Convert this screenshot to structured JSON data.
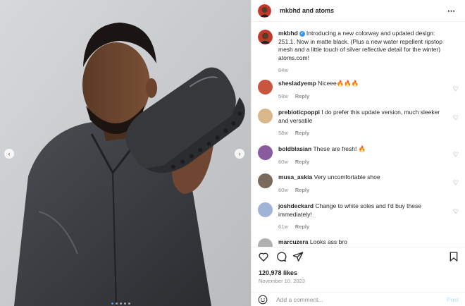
{
  "header": {
    "title": "mkbhd and atoms",
    "more_icon": "more-icon"
  },
  "caption": {
    "user": "mkbhd",
    "text": "Introducing a new colorway and updated design: 251.1. Now in matte black. (Plus a new water repellent ripstop mesh and a little touch of silver reflective detail for the winter) atoms.com!",
    "time": "64w"
  },
  "comments": [
    {
      "user": "shesladyemp",
      "text": "Niceee🔥🔥🔥",
      "time": "58w",
      "reply": "Reply",
      "avatar_color": "#c8553d"
    },
    {
      "user": "prebioticpoppi",
      "text": "I do prefer this update version, much sleeker and versatile",
      "time": "58w",
      "reply": "Reply",
      "avatar_color": "#d9b78a"
    },
    {
      "user": "boldblasian",
      "text": "These are fresh! 🔥",
      "time": "60w",
      "reply": "Reply",
      "avatar_color": "#8a5a9e"
    },
    {
      "user": "musa_askia",
      "text": "Very uncomfortable shoe",
      "time": "60w",
      "reply": "Reply",
      "avatar_color": "#7a6a5a"
    },
    {
      "user": "joshdeckard",
      "text": "Change to white soles and I'd buy these immediately!",
      "time": "61w",
      "reply": "Reply",
      "avatar_color": "#9fb4d6"
    },
    {
      "user": "marcuzera",
      "text": "Looks ass bro",
      "time": "",
      "reply": "",
      "avatar_color": "#b0b0b0"
    }
  ],
  "actions": {
    "likes": "120,978 likes",
    "date": "November 10, 2023"
  },
  "comment_input": {
    "placeholder": "Add a comment...",
    "post_label": "Post"
  },
  "carousel": {
    "slide_count": 5,
    "active_index": 0
  },
  "colors": {
    "accent": "#3897f0",
    "muted": "#8e8e8e",
    "post_disabled": "#b2dffc"
  }
}
